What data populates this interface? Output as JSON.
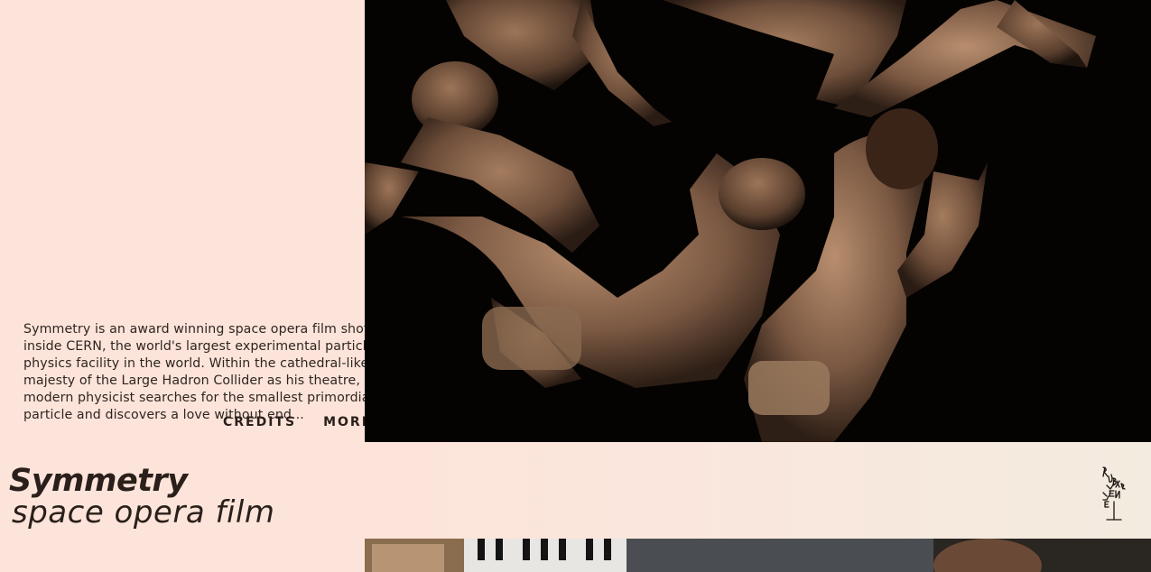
{
  "project": {
    "description": "Symmetry is an award winning space opera film shot inside CERN, the world's largest experimental particle physics facility in the world. Within the cathedral-like majesty of the Large Hadron Collider as his theatre, a modern physicist searches for the smallest primordial particle and discovers a love without end...",
    "links": {
      "credits": "CREDITS",
      "more_info": "MORE INFO"
    },
    "title": "Symmetry",
    "subtitle": "space opera film"
  },
  "logo": {
    "name": "Ruben van Leer"
  },
  "colors": {
    "background": "#fde4da",
    "text": "#2a1f1a",
    "hero_bg": "#050302"
  }
}
